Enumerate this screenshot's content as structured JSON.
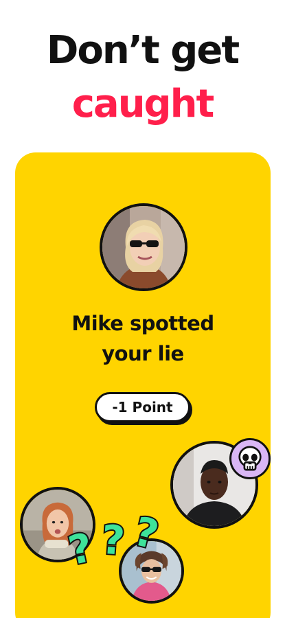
{
  "headline": {
    "line1": "Don’t get",
    "line2": "caught",
    "line1_color": "#111111",
    "line2_color": "#ff1f4b"
  },
  "card": {
    "background": "#ffd400",
    "message_line1": "Mike spotted",
    "message_line2": "your lie",
    "points_badge": "-1 Point"
  },
  "decorations": {
    "skull_icon": "skull-emoji",
    "skull_bg": "#d9b6f5",
    "question_marks_icon": "question-marks",
    "question_marks_color": "#3ee39a"
  }
}
